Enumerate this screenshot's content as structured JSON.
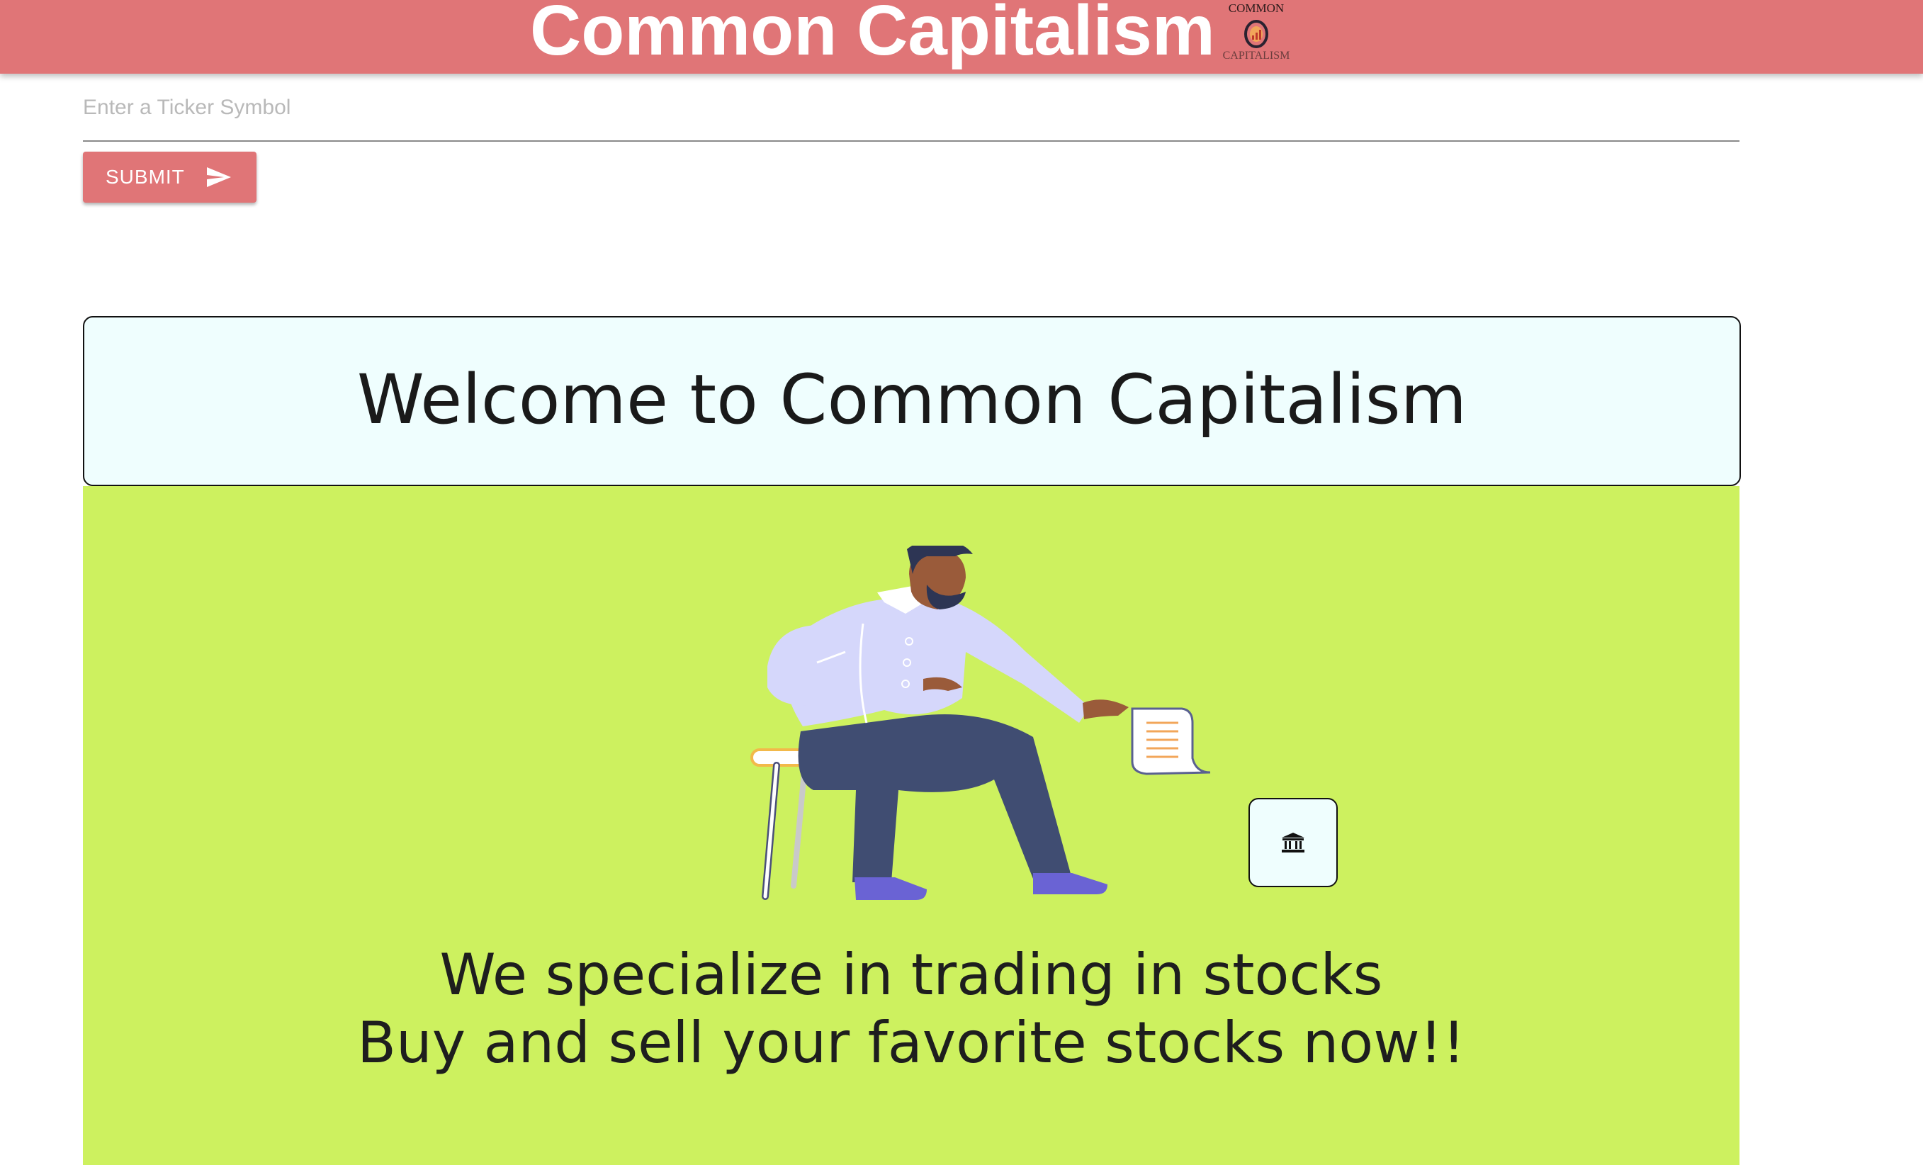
{
  "header": {
    "title": "Common Capitalism",
    "logo_top": "COMMON",
    "logo_bottom": "CAPITALISM",
    "background_color": "#e07577"
  },
  "search": {
    "placeholder": "Enter a Ticker Symbol",
    "value": "",
    "submit_label": "SUBMIT",
    "submit_icon": "send-icon"
  },
  "welcome": {
    "title": "Welcome to Common Capitalism"
  },
  "hero": {
    "background_color": "#cdf15f",
    "illustration": "person-reading-document-illustration",
    "action_icon": "bank-icon",
    "tagline_line1": "We specialize in trading in stocks",
    "tagline_line2": "Buy and sell your favorite stocks now!!"
  }
}
